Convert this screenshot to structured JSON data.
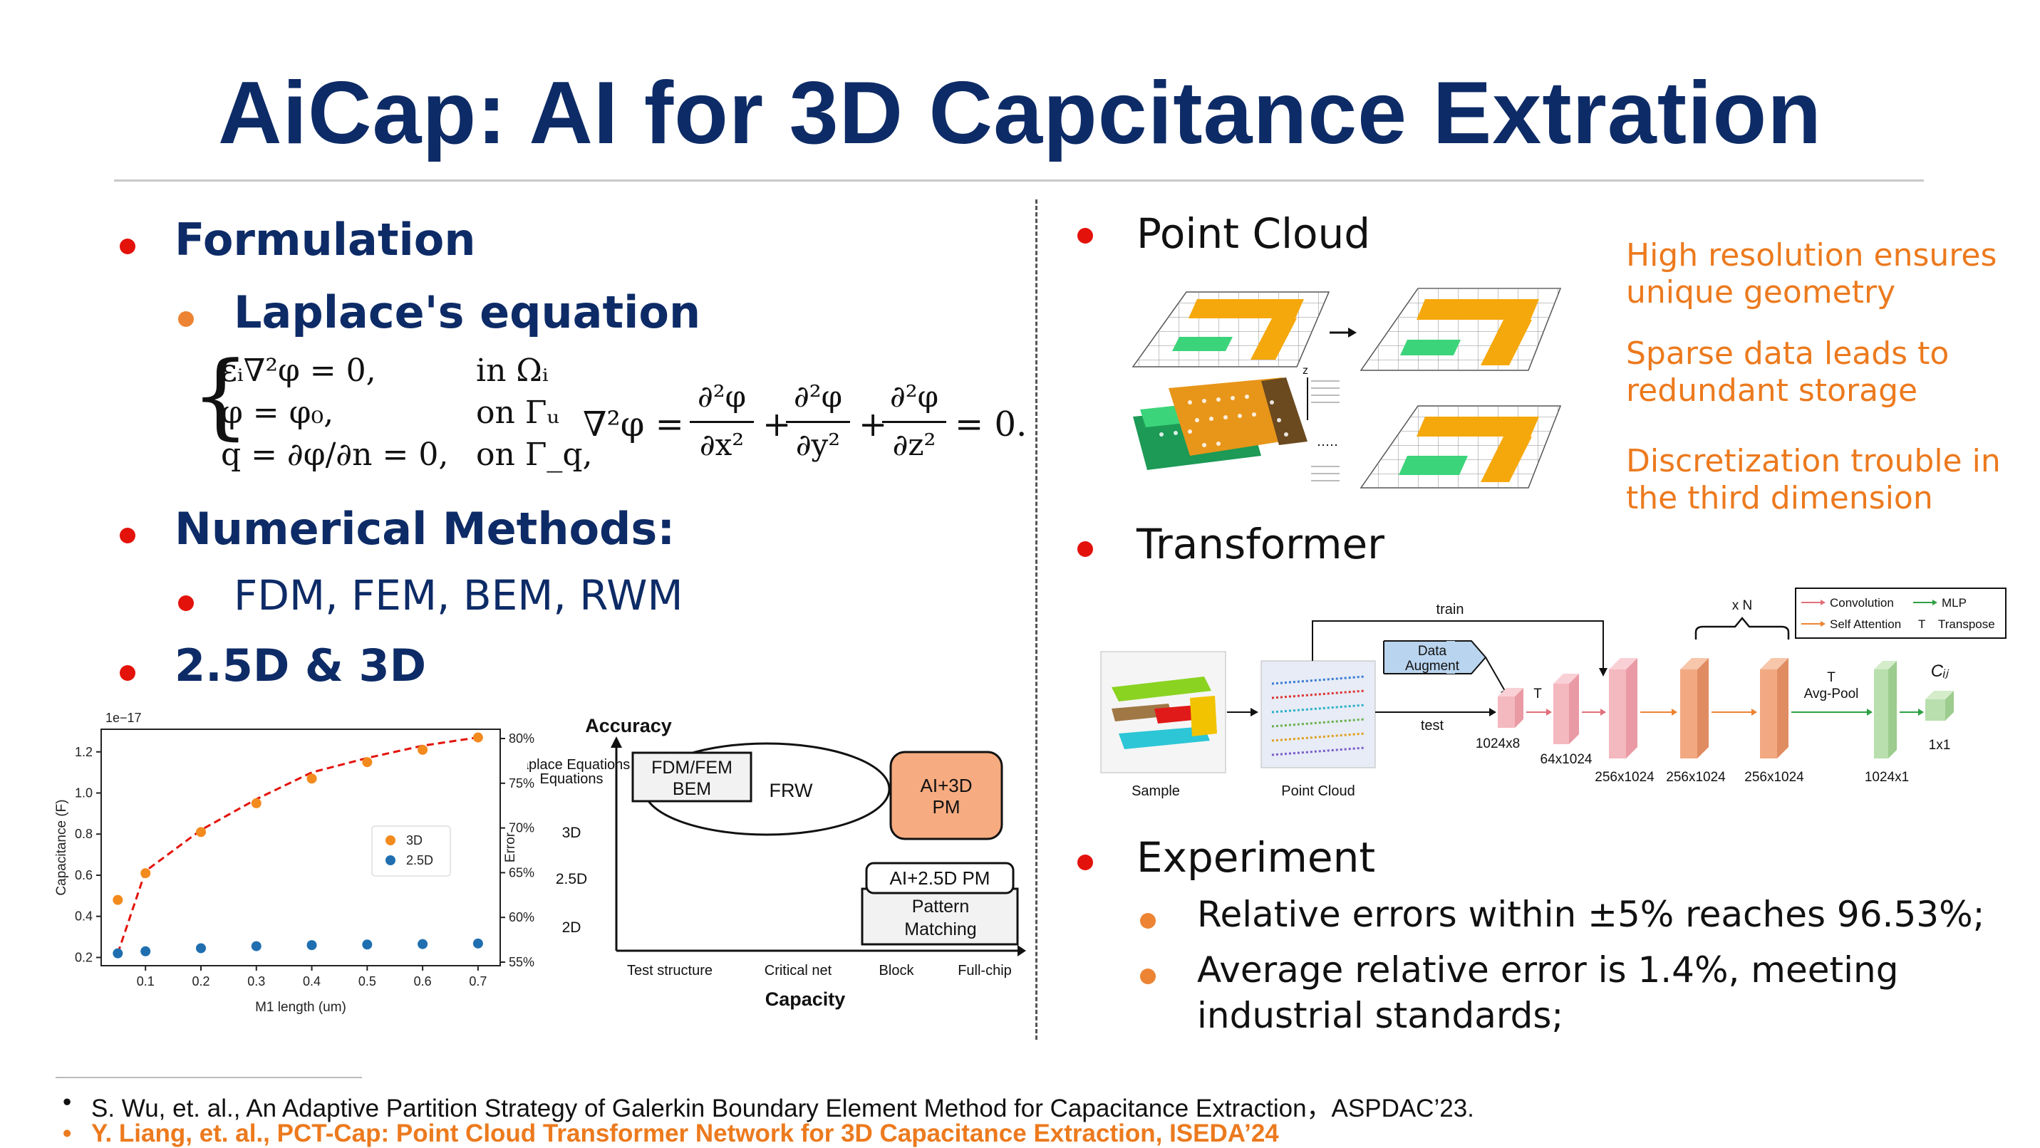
{
  "title": "AiCap: AI for 3D Capcitance Extration",
  "left": {
    "formulation": "Formulation",
    "laplace": "Laplace's equation",
    "equations": {
      "line1_lhs": "εᵢ∇²φ = 0,",
      "line1_rhs": "in Ωᵢ",
      "line2_lhs": "φ = φ₀,",
      "line2_rhs": "on Γᵤ",
      "line3_lhs": "q = ∂φ/∂n = 0,",
      "line3_rhs": "on Γ_q,",
      "laplacian_lhs": "∇²φ =",
      "term_x_num": "∂²φ",
      "term_x_den": "∂x²",
      "term_y_num": "∂²φ",
      "term_y_den": "∂y²",
      "term_z_num": "∂²φ",
      "term_z_den": "∂z²",
      "plus": "+",
      "rhs": "= 0."
    },
    "numerical": "Numerical Methods:",
    "methods": "FDM, FEM, BEM, RWM",
    "dims": "2.5D & 3D"
  },
  "chart_data": {
    "type": "scatter",
    "x": [
      0.05,
      0.1,
      0.2,
      0.3,
      0.4,
      0.5,
      0.6,
      0.7
    ],
    "series": [
      {
        "name": "3D",
        "values": [
          0.48,
          0.61,
          0.81,
          0.95,
          1.07,
          1.15,
          1.21,
          1.27
        ],
        "color": "#f28a1e"
      },
      {
        "name": "2.5D",
        "values": [
          0.22,
          0.23,
          0.245,
          0.255,
          0.26,
          0.263,
          0.265,
          0.268
        ],
        "color": "#1f6fb0"
      }
    ],
    "error_line": {
      "values": [
        0.22,
        0.62,
        0.82,
        0.97,
        1.1,
        1.17,
        1.23,
        1.27
      ],
      "color": "#e3120b"
    },
    "scale_label": "1e−17",
    "xlabel": "M1 length (um)",
    "ylabel": "Capacitance (F)",
    "y2label": "Error",
    "xticks": [
      "0.1",
      "0.2",
      "0.3",
      "0.4",
      "0.5",
      "0.6",
      "0.7"
    ],
    "xtick_values": [
      0.1,
      0.2,
      0.3,
      0.4,
      0.5,
      0.6,
      0.7
    ],
    "yticks": [
      "0.2",
      "0.4",
      "0.6",
      "0.8",
      "1.0",
      "1.2"
    ],
    "ytick_values": [
      0.2,
      0.4,
      0.6,
      0.8,
      1.0,
      1.2
    ],
    "y2ticks": [
      "55%",
      "60%",
      "65%",
      "70%",
      "75%",
      "80%"
    ],
    "xlim": [
      0.02,
      0.74
    ],
    "ylim": [
      0.16,
      1.31
    ],
    "legend": "center-right"
  },
  "accuracy_diagram": {
    "y_title": "Accuracy",
    "x_title": "Capacity",
    "y_labels": [
      "Laplace Equations",
      "3D",
      "2.5D",
      "2D"
    ],
    "x_labels": [
      "Test structure",
      "Critical net",
      "Block",
      "Full-chip"
    ],
    "fdm_box": [
      "FDM/FEM",
      "BEM"
    ],
    "frw": "FRW",
    "ai3d": [
      "AI+3D",
      "PM"
    ],
    "ai25d": "AI+2.5D PM",
    "pattern": [
      "Pattern",
      "Matching"
    ]
  },
  "right": {
    "point_cloud": "Point Cloud",
    "notes": [
      [
        "High resolution ensures",
        "unique geometry"
      ],
      [
        "Sparse data leads to",
        "redundant storage"
      ],
      [
        "Discretization trouble in",
        "the third dimension"
      ]
    ],
    "axis_z": "z",
    "transformer": "Transformer",
    "experiment": "Experiment",
    "exp1": "Relative errors within ±5% reaches 96.53%;",
    "exp2a": "Average relative error is 1.4%, meeting",
    "exp2b": "industrial standards;"
  },
  "pipeline": {
    "sample": "Sample",
    "point_cloud": "Point Cloud",
    "train": "train",
    "test": "test",
    "augment": [
      "Data",
      "Augment"
    ],
    "xN": "x N",
    "legend": {
      "conv": "Convolution",
      "mlp": "MLP",
      "attn": "Self Attention",
      "t": "T",
      "transpose": "Transpose"
    },
    "T": "T",
    "avgpool_T": "T",
    "avgpool": "Avg-Pool",
    "cij": "Cᵢⱼ",
    "dims": [
      "1024x8",
      "64x1024",
      "256x1024",
      "256x1024",
      "256x1024",
      "1024x1",
      "1x1"
    ],
    "colors": {
      "conv": "#e0707a",
      "mlp": "#2ea043",
      "attn": "#ec8433"
    }
  },
  "refs": [
    "S. Wu, et. al., An Adaptive Partition Strategy of Galerkin Boundary Element Method for Capacitance Extraction，ASPDAC’23.",
    "Y. Liang, et. al., PCT-Cap: Point Cloud Transformer Network for 3D Capacitance Extraction, ISEDA’24"
  ],
  "colors": {
    "title": "#0d2b66",
    "bullet_red": "#e3120b",
    "bullet_orange": "#ec8433",
    "note_orange": "#ec7a1e"
  }
}
